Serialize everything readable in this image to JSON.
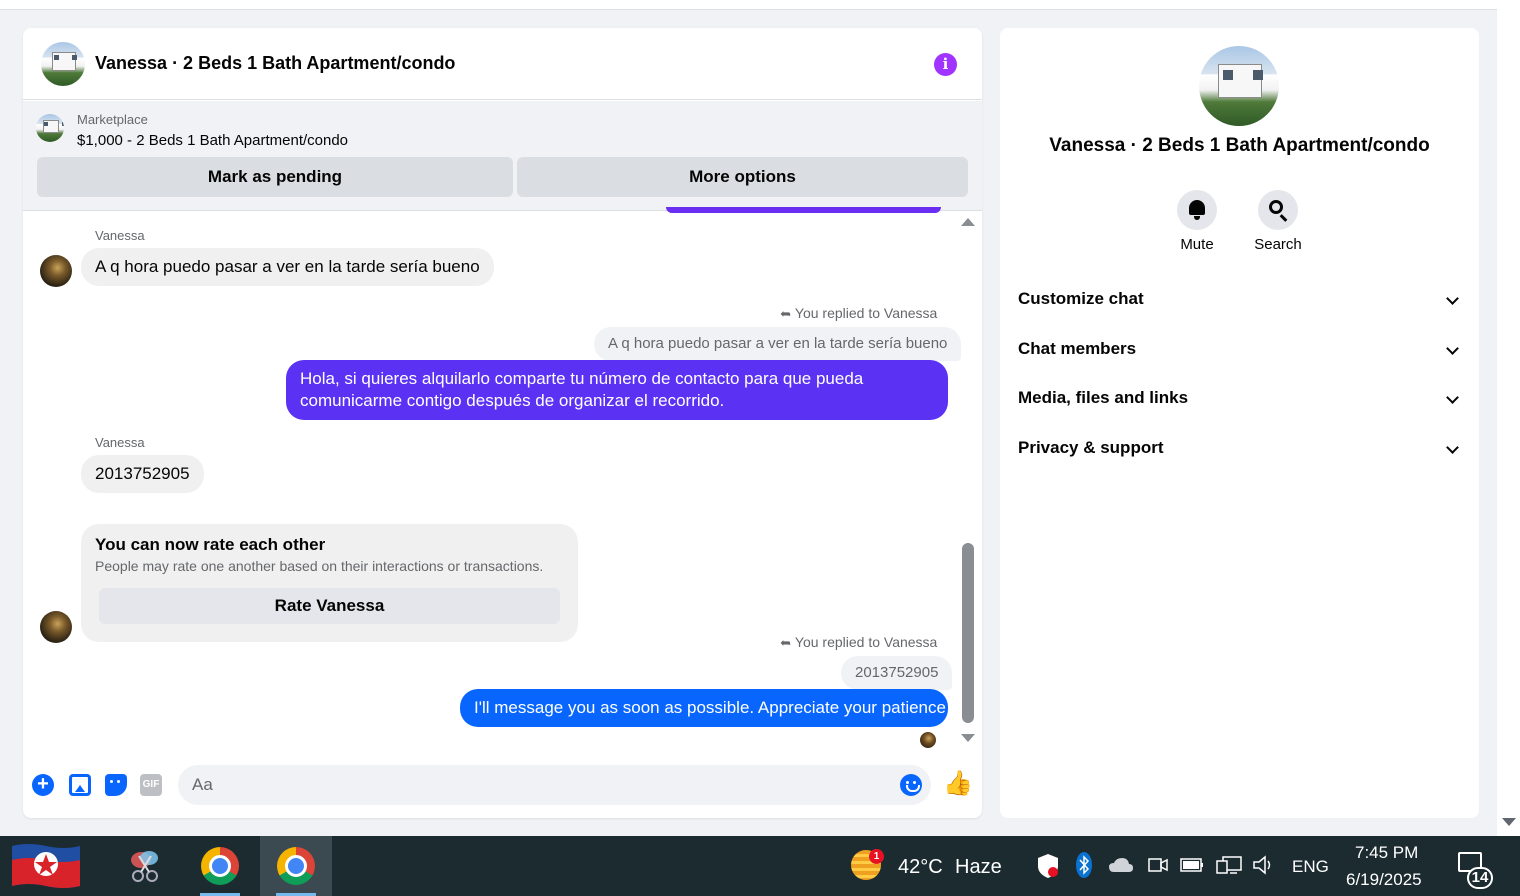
{
  "chat": {
    "title": "Vanessa · 2 Beds 1 Bath Apartment/condo",
    "marketplace_label": "Marketplace",
    "listing": "$1,000 - 2 Beds 1 Bath Apartment/condo",
    "mark_pending": "Mark as pending",
    "more_options": "More options",
    "messages": {
      "m1_sender": "Vanessa",
      "m1_text": "A q hora puedo pasar a ver en la tarde sería bueno",
      "reply1_note": "You replied to Vanessa",
      "reply1_quote": "A q hora puedo pasar a ver en la tarde sería bueno",
      "reply1_text": "Hola, si quieres alquilarlo comparte tu número de contacto para que pueda comunicarme contigo después de organizar el recorrido.",
      "m2_sender": "Vanessa",
      "m2_text": "2013752905",
      "rate_title": "You can now rate each other",
      "rate_sub": "People may rate one another based on their interactions or transactions.",
      "rate_button": "Rate Vanessa",
      "reply2_note": "You replied to Vanessa",
      "reply2_quote": "2013752905",
      "reply2_text": "I'll message you as soon as possible. Appreciate your patience"
    },
    "composer": {
      "placeholder": "Aa",
      "gif_label": "GIF",
      "plus_glyph": "+",
      "like_glyph": "👍"
    },
    "colors": {
      "outgoing_purple": "#5b31f4",
      "outgoing_blue": "#0866ff",
      "info_accent": "#a033ff"
    }
  },
  "info_panel": {
    "title": "Vanessa · 2 Beds 1 Bath Apartment/condo",
    "mute_label": "Mute",
    "search_label": "Search",
    "sections": [
      "Customize chat",
      "Chat members",
      "Media, files and links",
      "Privacy & support"
    ]
  },
  "taskbar": {
    "weather_badge": "1",
    "temperature": "42°C",
    "condition": "Haze",
    "language": "ENG",
    "time": "7:45 PM",
    "date": "6/19/2025",
    "notification_count": "14"
  }
}
